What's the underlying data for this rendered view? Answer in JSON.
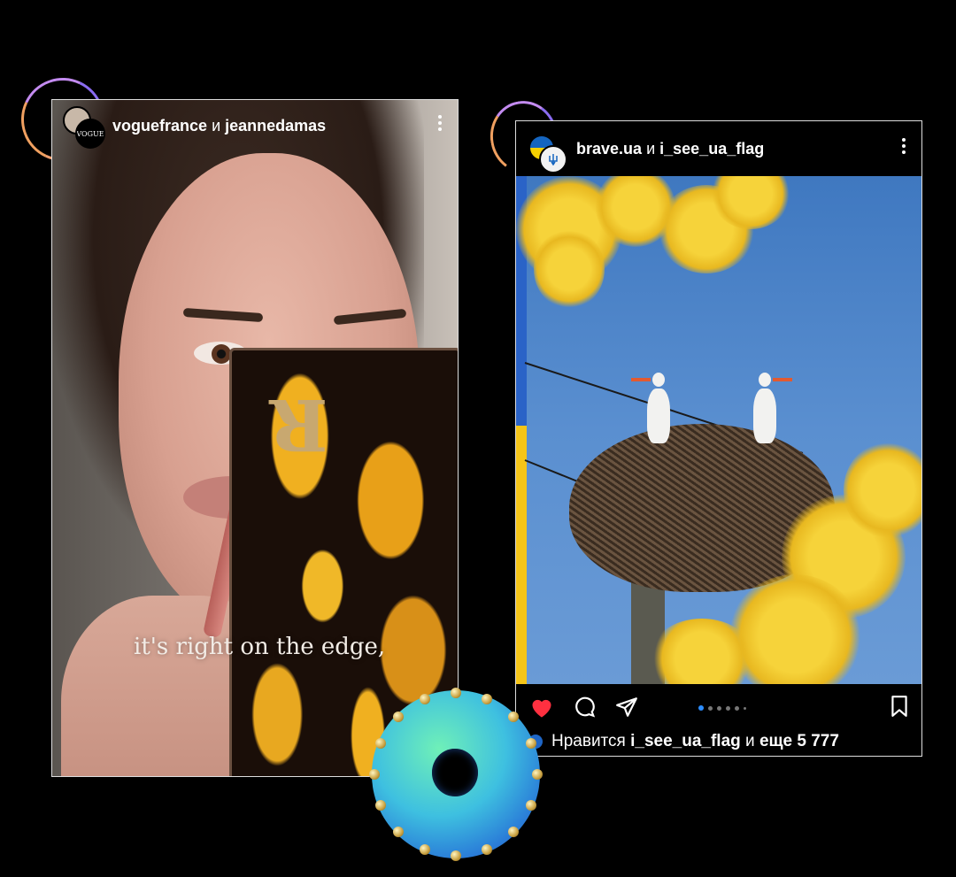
{
  "left_post": {
    "author_1": "voguefrance",
    "conjunction": "и",
    "author_2": "jeannedamas",
    "avatar_label": "VOGUE",
    "menu_icon": "more-vertical-icon",
    "caption": "it's right on the edge,",
    "mute_icon": "volume-muted-icon"
  },
  "right_post": {
    "author_1": "brave.ua",
    "conjunction": "и",
    "author_2": "i_see_ua_flag",
    "menu_icon": "more-vertical-icon",
    "actions": {
      "like_icon": "heart-filled-icon",
      "comment_icon": "comment-icon",
      "share_icon": "send-icon",
      "save_icon": "bookmark-icon"
    },
    "carousel": {
      "total": 6,
      "active_index": 0
    },
    "likes": {
      "prefix": "Нравится",
      "user": "i_see_ua_flag",
      "middle": "и",
      "count_text": "еще 5 777"
    }
  },
  "colors": {
    "background": "#000000",
    "like_red": "#ff3040",
    "carousel_active": "#2c8dff",
    "ua_blue": "#2a63c7",
    "ua_yellow": "#f5c518"
  }
}
